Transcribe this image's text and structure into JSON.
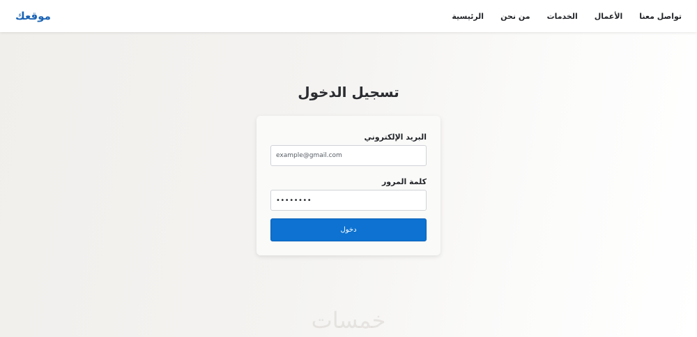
{
  "header": {
    "logo": "موقعك",
    "nav": [
      {
        "label": "الرئيسية"
      },
      {
        "label": "من نحن"
      },
      {
        "label": "الخدمات"
      },
      {
        "label": "الأعمال"
      },
      {
        "label": "تواصل معنا"
      }
    ]
  },
  "login": {
    "title": "تسجيل الدخول",
    "email_label": "البريد الإلكتروني",
    "email_value": "example@gmail.com",
    "password_label": "كلمة المرور",
    "password_value": "••••••••",
    "submit_label": "دخول"
  },
  "watermark": "خمسات",
  "colors": {
    "brand": "#1a63b5",
    "button": "#0d72d1"
  }
}
